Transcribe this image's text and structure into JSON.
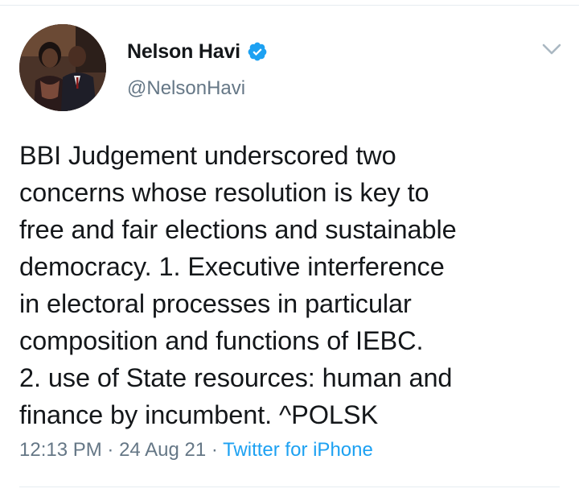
{
  "tweet": {
    "author": {
      "display_name": "Nelson Havi",
      "handle": "@NelsonHavi",
      "verified": true
    },
    "text": "BBI Judgement underscored two\nconcerns whose resolution is key to\nfree and fair elections and sustainable\ndemocracy. 1. Executive interference\nin electoral processes in particular\ncomposition and functions of IEBC.\n2. use of State resources: human and\nfinance by incumbent. ^POLSK",
    "time": "12:13 PM",
    "separator": " · ",
    "date": "24 Aug 21",
    "source": "Twitter for iPhone"
  },
  "colors": {
    "accent": "#1da1f2",
    "text": "#14171a",
    "secondary": "#657786",
    "divider": "#e6ecf0"
  },
  "icons": {
    "verified": "verified-badge-icon",
    "caret": "chevron-down-icon"
  }
}
